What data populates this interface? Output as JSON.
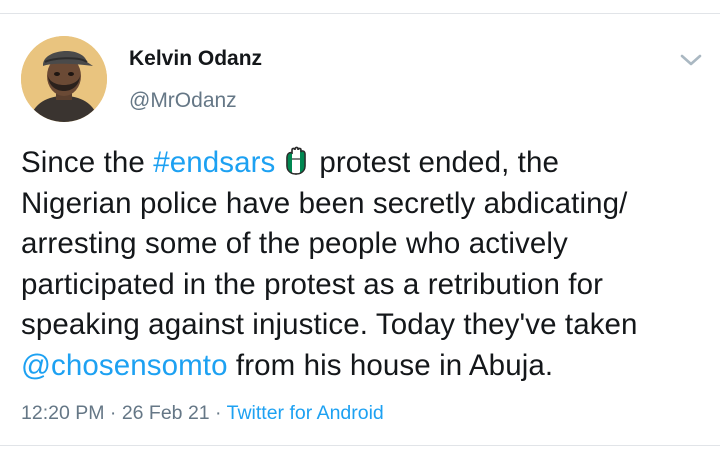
{
  "user": {
    "display_name": "Kelvin Odanz",
    "handle": "@MrOdanz",
    "avatar_icon": "profile-avatar"
  },
  "menu": {
    "icon": "chevron-down-icon"
  },
  "tweet": {
    "segments": {
      "l1_a": "Since the ",
      "hashtag": "#endsars",
      "emoji_icon": "raised-fist-nigeria-flag-icon",
      "l1_b": "protest ended, the",
      "l2": "Nigerian police have been secretly abdicating/",
      "l3": "arresting some of the people who actively",
      "l4": "participated in the protest as a retribution for",
      "l5": "speaking against injustice. Today they've taken",
      "mention": "@chosensomto",
      "l6_b": " from his house in Abuja."
    },
    "time": "12:20 PM",
    "separator": " · ",
    "date": "26 Feb 21",
    "source": "Twitter for Android"
  },
  "colors": {
    "link": "#1da1f2",
    "secondary_text": "#657786",
    "primary_text": "#14171a",
    "flag_green": "#008751"
  }
}
